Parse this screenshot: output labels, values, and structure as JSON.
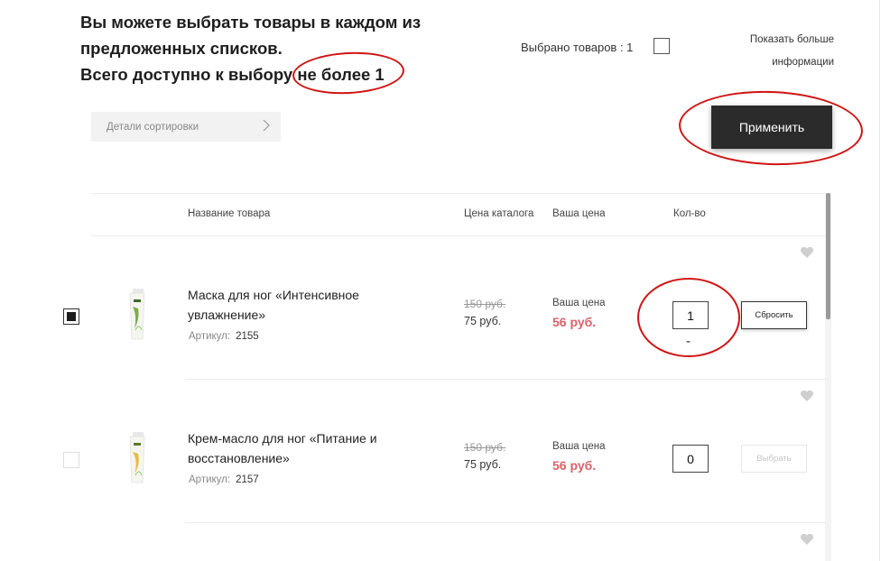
{
  "header": {
    "line1": "Вы можете выбрать товары в каждом из",
    "line2": "предложенных списков.",
    "line3_prefix": "Всего доступно к выбору ",
    "line3_limit": "не более 1",
    "selected_label": "Выбрано товаров : 1",
    "more_info_line1": "Показать больше",
    "more_info_line2": "информации"
  },
  "toolbar": {
    "sort_details": "Детали сортировки",
    "apply_button": "Применить"
  },
  "table": {
    "columns": [
      "Название товара",
      "Цена каталога",
      "Ваша цена",
      "Кол-во"
    ],
    "rows": [
      {
        "checked": true,
        "name_line1": "Маска для ног «Интенсивное",
        "name_line2": "увлажнение»",
        "article_label": "Артикул:",
        "article": "2155",
        "old_price": "150 руб.",
        "catalog_price": "75 руб.",
        "your_price_label": "Ваша цена",
        "your_price": "56 руб.",
        "quantity": "1",
        "minus": "-",
        "action": "Сбросить"
      },
      {
        "checked": false,
        "name_line1": "Крем-масло для ног «Питание и",
        "name_line2": "восстановление»",
        "article_label": "Артикул:",
        "article": "2157",
        "old_price": "150 руб.",
        "catalog_price": "75 руб.",
        "your_price_label": "Ваша цена",
        "your_price": "56 руб.",
        "quantity": "0",
        "action": "Выбрать"
      }
    ]
  },
  "colors": {
    "accent_price": "#d9616a",
    "apply_button_bg": "#2b2b2b",
    "annotation_ring": "#d01414"
  },
  "icons": {
    "sort_chevron": "chevron-right-icon",
    "favorite": "heart-icon",
    "product_image": "product-tube-thumbnail"
  }
}
